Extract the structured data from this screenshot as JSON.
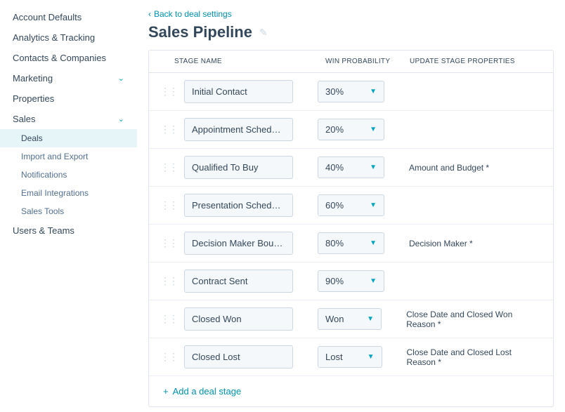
{
  "sidebar": {
    "items": [
      {
        "label": "Account Defaults",
        "expandable": false
      },
      {
        "label": "Analytics & Tracking",
        "expandable": false
      },
      {
        "label": "Contacts & Companies",
        "expandable": false
      },
      {
        "label": "Marketing",
        "expandable": true
      },
      {
        "label": "Properties",
        "expandable": false
      },
      {
        "label": "Sales",
        "expandable": true,
        "expanded": true
      },
      {
        "label": "Users & Teams",
        "expandable": false
      }
    ],
    "sales_subitems": [
      {
        "label": "Deals",
        "active": true
      },
      {
        "label": "Import and Export"
      },
      {
        "label": "Notifications"
      },
      {
        "label": "Email Integrations"
      },
      {
        "label": "Sales Tools"
      }
    ]
  },
  "header": {
    "back_label": "Back to deal settings",
    "title": "Sales Pipeline"
  },
  "table": {
    "columns": {
      "stage": "STAGE NAME",
      "probability": "WIN PROBABILITY",
      "properties": "UPDATE STAGE PROPERTIES"
    },
    "stages": [
      {
        "name": "Initial Contact",
        "probability": "30%",
        "properties": ""
      },
      {
        "name": "Appointment Scheduled",
        "probability": "20%",
        "properties": ""
      },
      {
        "name": "Qualified To Buy",
        "probability": "40%",
        "properties": "Amount and Budget *"
      },
      {
        "name": "Presentation Scheduled",
        "probability": "60%",
        "properties": ""
      },
      {
        "name": "Decision Maker Bought-",
        "probability": "80%",
        "properties": "Decision Maker *"
      },
      {
        "name": "Contract Sent",
        "probability": "90%",
        "properties": ""
      },
      {
        "name": "Closed Won",
        "probability": "Won",
        "properties": "Close Date and Closed Won Reason *"
      },
      {
        "name": "Closed Lost",
        "probability": "Lost",
        "properties": "Close Date and Closed Lost Reason *"
      }
    ],
    "add_label": "Add a deal stage"
  }
}
